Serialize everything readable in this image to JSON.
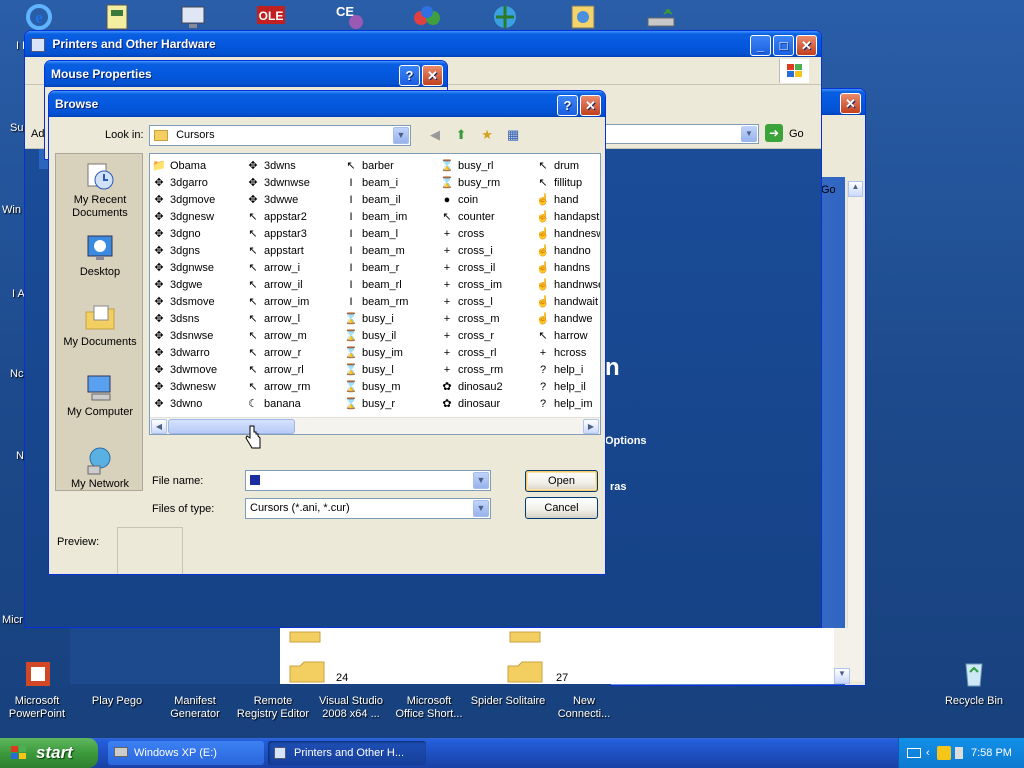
{
  "desktop": {
    "left_labels": [
      "I E",
      "Su",
      "Win",
      "I A",
      "Nc",
      "N",
      "Micr"
    ],
    "bottom_icons": [
      {
        "label": "Microsoft PowerPoint",
        "line1": "Microsoft",
        "line2": "PowerPoint"
      },
      {
        "label": "Play Pego",
        "line1": "Play Pego",
        "line2": ""
      },
      {
        "label": "Manifest Generator",
        "line1": "Manifest",
        "line2": "Generator"
      },
      {
        "label": "Remote Registry Editor",
        "line1": "Remote",
        "line2": "Registry Editor"
      },
      {
        "label": "Visual Studio 2008 x64 ...",
        "line1": "Visual Studio",
        "line2": "2008 x64 ..."
      },
      {
        "label": "Microsoft Office Short...",
        "line1": "Microsoft",
        "line2": "Office Short..."
      },
      {
        "label": "Spider Solitaire",
        "line1": "Spider Solitaire",
        "line2": ""
      },
      {
        "label": "New Connecti...",
        "line1": "New",
        "line2": "Connecti..."
      }
    ],
    "recycle_bin": "Recycle Bin"
  },
  "printers_window": {
    "title": "Printers and Other Hardware",
    "go_label": "Go",
    "address_label": "Ad",
    "side_text_1": "Options",
    "side_text_2": "ras",
    "side_text_3": "n",
    "folder_label_1": "24",
    "folder_label_2": "27"
  },
  "mouse_properties": {
    "title": "Mouse Properties"
  },
  "browse": {
    "title": "Browse",
    "look_in_label": "Look in:",
    "look_in_value": "Cursors",
    "places": [
      "My Recent Documents",
      "Desktop",
      "My Documents",
      "My Computer",
      "My Network"
    ],
    "places_lines": [
      [
        "My Recent",
        "Documents"
      ],
      [
        "Desktop"
      ],
      [
        "My Documents"
      ],
      [
        "My Computer"
      ],
      [
        "My Network"
      ]
    ],
    "columns": [
      [
        "Obama",
        "3dgarro",
        "3dgmove",
        "3dgnesw",
        "3dgno",
        "3dgns",
        "3dgnwse",
        "3dgwe",
        "3dsmove",
        "3dsns",
        "3dsnwse",
        "3dwarro",
        "3dwmove",
        "3dwnesw",
        "3dwno"
      ],
      [
        "3dwns",
        "3dwnwse",
        "3dwwe",
        "appstar2",
        "appstar3",
        "appstart",
        "arrow_i",
        "arrow_il",
        "arrow_im",
        "arrow_l",
        "arrow_m",
        "arrow_r",
        "arrow_rl",
        "arrow_rm",
        "banana"
      ],
      [
        "barber",
        "beam_i",
        "beam_il",
        "beam_im",
        "beam_l",
        "beam_m",
        "beam_r",
        "beam_rl",
        "beam_rm",
        "busy_i",
        "busy_il",
        "busy_im",
        "busy_l",
        "busy_m",
        "busy_r"
      ],
      [
        "busy_rl",
        "busy_rm",
        "coin",
        "counter",
        "cross",
        "cross_i",
        "cross_il",
        "cross_im",
        "cross_l",
        "cross_m",
        "cross_r",
        "cross_rl",
        "cross_rm",
        "dinosau2",
        "dinosaur"
      ],
      [
        "drum",
        "fillitup",
        "hand",
        "handapst",
        "handnesw",
        "handno",
        "handns",
        "handnwse",
        "handwait",
        "handwe",
        "harrow",
        "hcross",
        "help_i",
        "help_il",
        "help_im"
      ]
    ],
    "file_name_label": "File name:",
    "file_name_value": "",
    "files_of_type_label": "Files of type:",
    "files_of_type_value": "Cursors (*.ani, *.cur)",
    "open_label": "Open",
    "cancel_label": "Cancel",
    "preview_label": "Preview:"
  },
  "taskbar": {
    "start_label": "start",
    "tasks": [
      "Windows XP (E:)",
      "Printers and Other H..."
    ],
    "clock": "7:58 PM"
  }
}
